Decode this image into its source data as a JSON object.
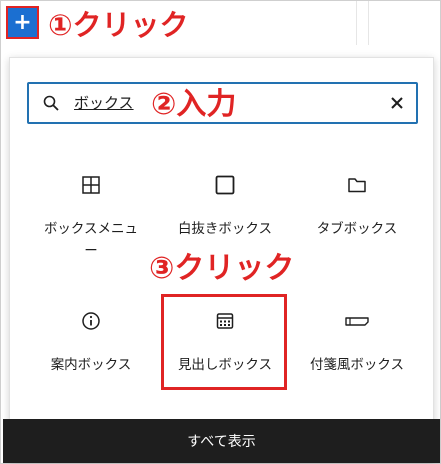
{
  "toolbar": {
    "add_block_label": "+"
  },
  "annotations": {
    "step1": "①クリック",
    "step2": "②入力",
    "step3": "③クリック"
  },
  "search": {
    "value": "ボックス"
  },
  "blocks": [
    {
      "label": "ボックスメニュー",
      "icon": "grid-icon"
    },
    {
      "label": "白抜きボックス",
      "icon": "square-icon"
    },
    {
      "label": "タブボックス",
      "icon": "folder-icon"
    },
    {
      "label": "案内ボックス",
      "icon": "info-icon"
    },
    {
      "label": "見出しボックス",
      "icon": "calendar-icon"
    },
    {
      "label": "付箋風ボックス",
      "icon": "sticky-note-icon"
    }
  ],
  "footer": {
    "browse_all_label": "すべて表示"
  },
  "colors": {
    "accent": "#1b6fd1",
    "annotation": "#e02424",
    "focus": "#2271b1",
    "footer_bg": "#1e1e1e"
  }
}
